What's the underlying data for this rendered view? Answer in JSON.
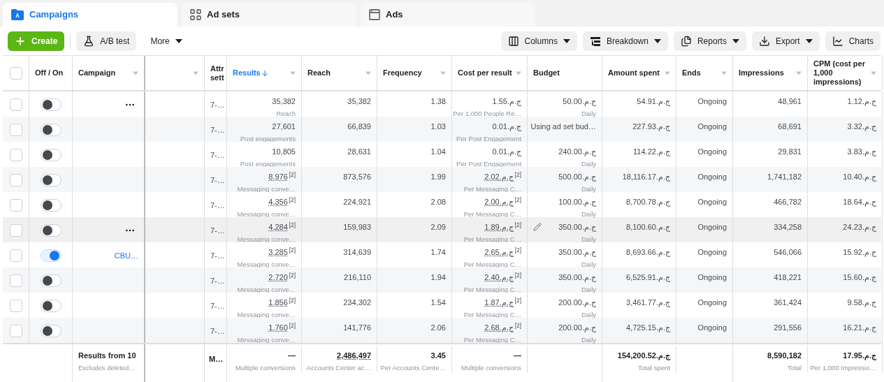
{
  "tabs": [
    {
      "label": "Campaigns",
      "kind": "folder",
      "selected": true
    },
    {
      "label": "Ad sets",
      "kind": "grid",
      "selected": false
    },
    {
      "label": "Ads",
      "kind": "window",
      "selected": false
    }
  ],
  "toolbar": {
    "left": [
      {
        "label": "Create",
        "kind": "create"
      },
      {
        "label": "A/B test",
        "kind": "flask"
      },
      {
        "label": "More",
        "kind": "more"
      }
    ],
    "right": [
      {
        "label": "Columns",
        "kind": "columns"
      },
      {
        "label": "Breakdown",
        "kind": "breakdown"
      },
      {
        "label": "Reports",
        "kind": "reports"
      },
      {
        "label": "Export",
        "kind": "export"
      },
      {
        "label": "Charts",
        "kind": "charts"
      }
    ]
  },
  "table": {
    "header_checkbox": {
      "checked": false
    },
    "columns": [
      {
        "label": "Off / On",
        "menu": false,
        "sorted": false
      },
      {
        "label": "Campaign",
        "menu": true,
        "sorted": false
      },
      {
        "menu": true,
        "sorted": false
      },
      {
        "label": "Attr sett",
        "sorted": false
      },
      {
        "label": "Results",
        "menu": true,
        "sorted": true
      },
      {
        "label": "Reach",
        "menu": true,
        "sorted": false
      },
      {
        "label": "Frequency",
        "menu": true,
        "sorted": false
      },
      {
        "label": "Cost per result",
        "menu": true,
        "sorted": false
      },
      {
        "label": "Budget",
        "menu": false,
        "sorted": false
      },
      {
        "label": "Amount spent",
        "menu": true,
        "sorted": false
      },
      {
        "label": "Ends",
        "menu": true,
        "sorted": false
      },
      {
        "label": "Impressions",
        "menu": true,
        "sorted": false
      },
      {
        "label": "CPM (cost per 1,000 impressions)",
        "menu": true,
        "sorted": false
      }
    ],
    "rows": [
      {
        "checked": false,
        "on": false,
        "more": true,
        "attribution": "7-…",
        "results": "35,382",
        "results_label": "Reach",
        "reach": "35,382",
        "frequency": "1.38",
        "cost": "ج.م.1.55",
        "cost_label": "Per 1,000 People Re…",
        "edit": false,
        "budget": "ج.م.50.00",
        "budget_label": "Daily",
        "spent": "ج.م.54.91",
        "ends": "Ongoing",
        "impressions": "48,961",
        "cpm": "ج.م.1.12"
      },
      {
        "checked": false,
        "on": false,
        "more": false,
        "attribution": "7-…",
        "results": "27,601",
        "results_label": "Post engagements",
        "reach": "66,839",
        "frequency": "1.03",
        "cost": "ج.م.0.01",
        "cost_label": "Per Post Engagement",
        "edit": false,
        "budget": "Using ad set bud…",
        "spent": "ج.م.227.93",
        "ends": "Ongoing",
        "impressions": "68,691",
        "cpm": "ج.م.3.32"
      },
      {
        "checked": false,
        "on": false,
        "more": false,
        "attribution": "7-…",
        "results": "10,805",
        "results_label": "Post engagements",
        "reach": "28,631",
        "frequency": "1.04",
        "cost": "ج.م.0.01",
        "cost_label": "Per Post Engagement",
        "edit": false,
        "budget": "ج.م.240.00",
        "budget_label": "Daily",
        "spent": "ج.م.114.22",
        "ends": "Ongoing",
        "impressions": "29,831",
        "cpm": "ج.م.3.83"
      },
      {
        "checked": false,
        "on": false,
        "more": false,
        "attribution": "7-…",
        "results": "8,976$^{[2]}$",
        "results_label": "Messaging conve…",
        "reach": "873,576",
        "frequency": "1.99",
        "cost": "ج.م.2.02$^{[2]}$",
        "cost_label": "Per Messaging C…",
        "edit": false,
        "budget": "ج.م.500.00",
        "budget_label": "Daily",
        "spent": "ج.م.18,116.17",
        "ends": "Ongoing",
        "impressions": "1,741,182",
        "cpm": "ج.م.10.40"
      },
      {
        "checked": false,
        "on": false,
        "more": false,
        "attribution": "7-…",
        "results": "4,356$^{[2]}$",
        "results_label": "Messaging conve…",
        "reach": "224,921",
        "frequency": "2.08",
        "cost": "ج.م.2.00$^{[2]}$",
        "cost_label": "Per Messaging C…",
        "edit": false,
        "budget": "ج.م.100.00",
        "budget_label": "Daily",
        "spent": "ج.م.8,700.78",
        "ends": "Ongoing",
        "impressions": "466,782",
        "cpm": "ج.م.18.64"
      },
      {
        "checked": false,
        "on": false,
        "more": true,
        "attribution": "7-…",
        "results": "4,284$^{[2]}$",
        "results_label": "Messaging conve…",
        "reach": "159,983",
        "frequency": "2.09",
        "cost": "ج.م.1.89$^{[2]}$",
        "cost_label": "Per Messaging C…",
        "edit": true,
        "budget": "ج.م.350.00",
        "budget_label": "Daily",
        "spent": "ج.م.8,100.60",
        "ends": "Ongoing",
        "impressions": "334,258",
        "cpm": "ج.م.24.23"
      },
      {
        "checked": false,
        "on": true,
        "name": "CBU…",
        "more": false,
        "attribution": "7-…",
        "results": "3,285$^{[2]}$",
        "results_label": "Messaging conve…",
        "reach": "314,639",
        "frequency": "1.74",
        "cost": "ج.م.2.65$^{[2]}$",
        "cost_label": "Per Messaging C…",
        "edit": false,
        "budget": "ج.م.350.00",
        "budget_label": "Daily",
        "spent": "ج.م.8,693.66",
        "ends": "Ongoing",
        "impressions": "546,066",
        "cpm": "ج.م.15.92"
      },
      {
        "checked": false,
        "on": false,
        "more": false,
        "attribution": "7-…",
        "results": "2,720$^{[2]}$",
        "results_label": "Messaging conve…",
        "reach": "216,110",
        "frequency": "1.94",
        "cost": "ج.م.2.40$^{[2]}$",
        "cost_label": "Per Messaging C…",
        "edit": false,
        "budget": "ج.م.350.00",
        "budget_label": "Daily",
        "spent": "ج.م.6,525.91",
        "ends": "Ongoing",
        "impressions": "418,221",
        "cpm": "ج.م.15.60"
      },
      {
        "checked": false,
        "on": false,
        "more": false,
        "attribution": "7-…",
        "results": "1,856$^{[2]}$",
        "results_label": "Messaging conve…",
        "reach": "234,302",
        "frequency": "1.54",
        "cost": "ج.م.1.87$^{[2]}$",
        "cost_label": "Per Messaging C…",
        "edit": false,
        "budget": "ج.م.200.00",
        "budget_label": "Daily",
        "spent": "ج.م.3,461.77",
        "ends": "Ongoing",
        "impressions": "361,424",
        "cpm": "ج.م.9.58"
      },
      {
        "checked": false,
        "on": false,
        "more": false,
        "attribution": "7-…",
        "results": "1,760$^{[2]}$",
        "results_label": "Messaging conve…",
        "reach": "141,776",
        "frequency": "2.06",
        "cost": "ج.م.2.68$^{[2]}$",
        "cost_label": "Per Messaging C…",
        "edit": false,
        "budget": "ج.م.200.00",
        "budget_label": "Daily",
        "spent": "ج.م.4,725.15",
        "ends": "Ongoing",
        "impressions": "291,556",
        "cpm": "ج.م.16.21"
      }
    ],
    "totals": {
      "campaign": "Results from 10",
      "campaign_label": "Excludes deleted…",
      "attribution": "M…",
      "results": "—",
      "results_label": "Multiple conversions",
      "reach": "2,486,497",
      "reach_label": "Accounts Center ac…",
      "frequency": "3.45",
      "frequency_label": "Per Accounts Cente…",
      "cost": "—",
      "cost_label": "Multiple conversions",
      "spent": "ج.م.154,200.52",
      "spent_label": "Total spent",
      "impressions": "8,590,182",
      "impressions_label": "Total",
      "cpm": "ج.م.17.95",
      "cpm_label": "Per 1,000 Impressio…"
    }
  }
}
